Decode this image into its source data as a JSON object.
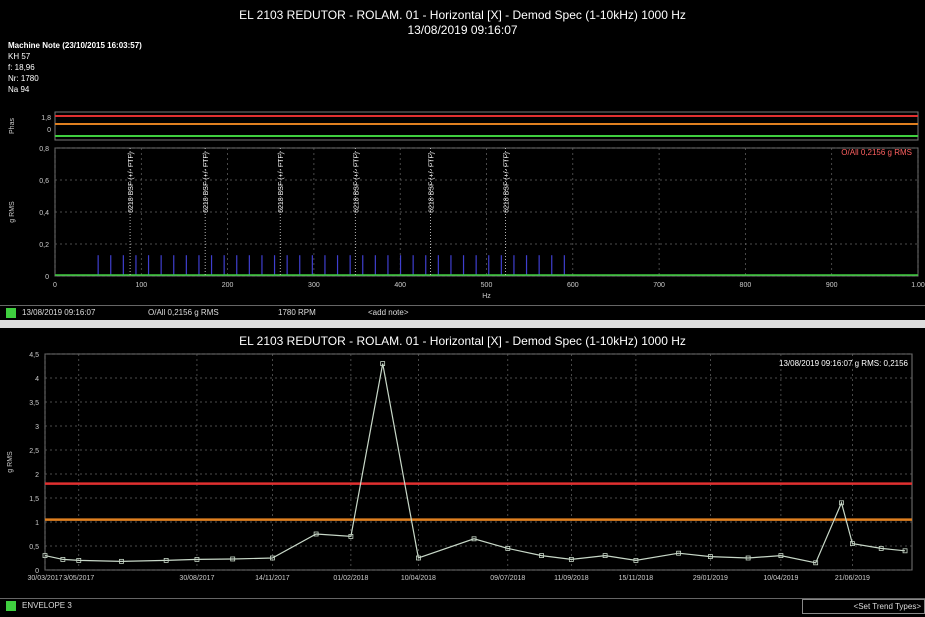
{
  "top": {
    "title_line1": "EL 2103 REDUTOR - ROLAM. 01 - Horizontal [X] - Demod Spec (1-10kHz) 1000 Hz",
    "title_line2": "13/08/2019 09:16:07",
    "machine_note": {
      "title": "Machine Note (23/10/2015 16:03:57)",
      "lines": [
        "KH 57",
        "f: 18,96",
        "Nr: 1780",
        "Na 94"
      ]
    },
    "overall_label": "O/All 0,2156 g RMS",
    "status": {
      "timestamp": "13/08/2019 09:16:07",
      "overall": "O/All 0,2156 g RMS",
      "rpm": "1780 RPM",
      "note": "<add note>"
    }
  },
  "bottom": {
    "title": "EL 2103 REDUTOR - ROLAM. 01 - Horizontal [X] - Demod Spec (1-10kHz) 1000 Hz",
    "annotation": "13/08/2019 09:16:07 g RMS: 0,2156",
    "status": {
      "label": "ENVELOPE 3",
      "button": "<Set Trend Types>"
    }
  },
  "chart_data": [
    {
      "type": "bar",
      "title": "EL 2103 REDUTOR - ROLAM. 01 - Horizontal [X] - Demod Spec (1-10kHz) 1000 Hz",
      "xlabel": "Hz",
      "ylabel": "g RMS",
      "xlim": [
        0,
        1000
      ],
      "ylim": [
        0,
        0.8
      ],
      "xticks": [
        "0",
        "100",
        "200",
        "300",
        "400",
        "500",
        "600",
        "700",
        "800",
        "900",
        "1.00"
      ],
      "yticks": [
        "0",
        "0,2",
        "0,4",
        "0,6",
        "0,8"
      ],
      "phase_label": "Phas",
      "phase_ticks": [
        "1,8",
        "0"
      ],
      "fault_markers": [
        {
          "x": 87,
          "label": "6218 BSF (+/- FTF)"
        },
        {
          "x": 174,
          "label": "6218 BSF (+/- FTF)"
        },
        {
          "x": 261,
          "label": "6218 BSF (+/- FTF)"
        },
        {
          "x": 348,
          "label": "6218 BSF (+/- FTF)"
        },
        {
          "x": 435,
          "label": "6218 BSF (+/- FTF)"
        },
        {
          "x": 522,
          "label": "6218 BSF (+/- FTF)"
        }
      ],
      "spectral_lines": {
        "start": 50,
        "end": 595,
        "step": 14.6,
        "amplitude": 0.13
      },
      "series_colors": {
        "spectrum": "#3f3fcf",
        "baseline": "#3fcf3f",
        "markers": "#dddddd"
      },
      "alarm_colors": {
        "high": "#e03030",
        "low": "#e08020",
        "phase": "#3fcf3f"
      }
    },
    {
      "type": "line",
      "title": "EL 2103 REDUTOR - ROLAM. 01 - Horizontal [X] - Demod Spec (1-10kHz) 1000 Hz",
      "ylabel": "g RMS",
      "ylim": [
        0,
        4.5
      ],
      "yticks": [
        "0",
        "0,5",
        "1",
        "1,5",
        "2",
        "2,5",
        "3",
        "3,5",
        "4",
        "4,5"
      ],
      "xticks": [
        "30/03/2017",
        "3/05/2017",
        "30/08/2017",
        "14/11/2017",
        "01/02/2018",
        "10/04/2018",
        "09/07/2018",
        "11/09/2018",
        "15/11/2018",
        "29/01/2019",
        "10/04/2019",
        "21/06/2019"
      ],
      "x": [
        "2017-03-30",
        "2017-04-17",
        "2017-05-03",
        "2017-06-15",
        "2017-07-30",
        "2017-08-30",
        "2017-10-05",
        "2017-11-14",
        "2017-12-28",
        "2018-02-01",
        "2018-03-05",
        "2018-04-10",
        "2018-06-05",
        "2018-07-09",
        "2018-08-12",
        "2018-09-11",
        "2018-10-15",
        "2018-11-15",
        "2018-12-28",
        "2019-01-29",
        "2019-03-08",
        "2019-04-10",
        "2019-05-15",
        "2019-06-10",
        "2019-06-21",
        "2019-07-20",
        "2019-08-13"
      ],
      "values": [
        0.3,
        0.22,
        0.2,
        0.18,
        0.2,
        0.22,
        0.23,
        0.25,
        0.75,
        0.7,
        4.3,
        0.25,
        0.65,
        0.45,
        0.3,
        0.22,
        0.3,
        0.2,
        0.35,
        0.28,
        0.25,
        0.3,
        0.15,
        1.4,
        0.55,
        0.45,
        0.4
      ],
      "alarm_levels": [
        {
          "value": 1.8,
          "color": "#e03030"
        },
        {
          "value": 1.05,
          "color": "#e08020"
        }
      ],
      "series_color": "#c8d8c8"
    }
  ]
}
